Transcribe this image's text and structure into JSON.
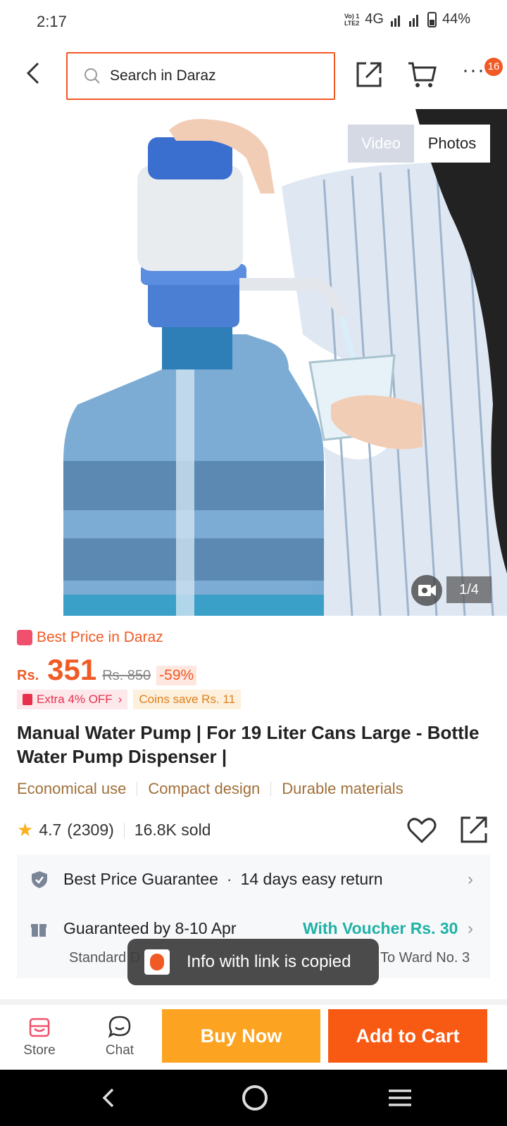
{
  "status": {
    "time": "2:17",
    "network_top": "Vo) 1",
    "network_bottom": "LTE2",
    "network_type": "4G",
    "battery": "44%"
  },
  "header": {
    "search_placeholder": "Search in Daraz",
    "cart_badge": "16"
  },
  "gallery": {
    "tab_video": "Video",
    "tab_photos": "Photos",
    "active_tab": "Photos",
    "page_indicator": "1/4"
  },
  "product": {
    "badge": "Best Price in Daraz",
    "currency": "Rs.",
    "price": "351",
    "old_price": "Rs. 850",
    "discount": "-59%",
    "promo_extra": "Extra 4% OFF",
    "promo_coins": "Coins save Rs. 11",
    "title": "Manual Water Pump | For 19 Liter Cans Large - Bottle Water Pump Dispenser |",
    "features": [
      "Economical use",
      "Compact design",
      "Durable materials"
    ],
    "rating": "4.7",
    "rating_count": "(2309)",
    "sold": "16.8K sold"
  },
  "info": {
    "guarantee": "Best Price Guarantee",
    "returns": "14 days easy return",
    "delivery": "Guaranteed by 8-10 Apr",
    "voucher": "With Voucher Rs. 30",
    "delivery_type_partial": "Standard D",
    "delivery_to_partial": "To Ward No. 3"
  },
  "toast": {
    "message": "Info with link is copied"
  },
  "actions": {
    "store": "Store",
    "chat": "Chat",
    "buy_now": "Buy Now",
    "add_to_cart": "Add to Cart"
  },
  "colors": {
    "brand": "#f05a24",
    "buy_now": "#fca421",
    "add_to_cart": "#f85a14",
    "voucher": "#20b2a6"
  }
}
